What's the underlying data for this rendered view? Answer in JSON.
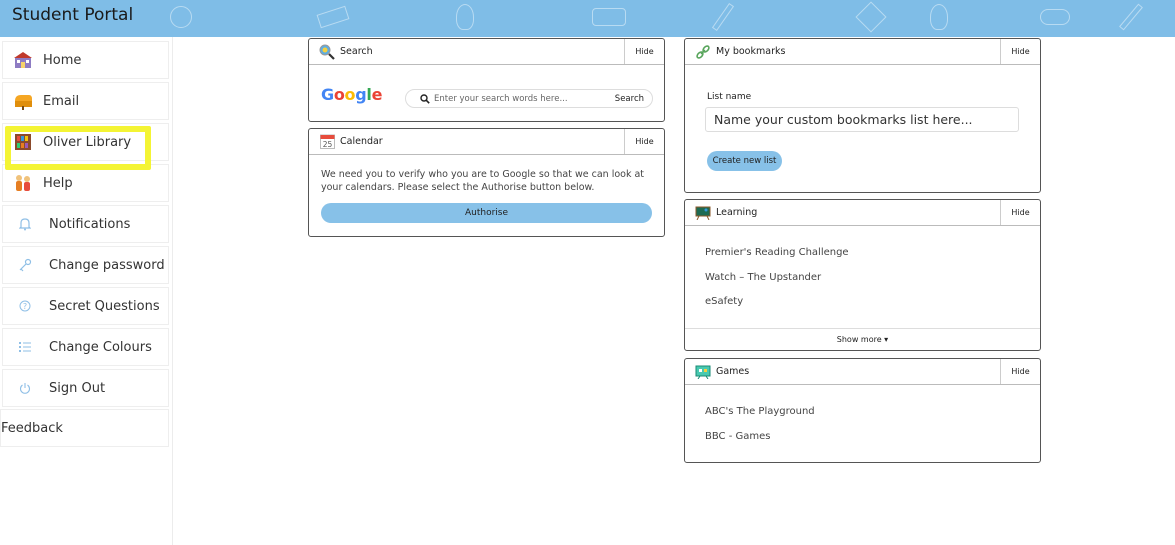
{
  "header": {
    "title": "Student Portal"
  },
  "sidebar": {
    "items": [
      {
        "label": "Home",
        "icon": "school-icon"
      },
      {
        "label": "Email",
        "icon": "mailbox-icon"
      },
      {
        "label": "Oliver Library",
        "icon": "library-icon"
      },
      {
        "label": "Help",
        "icon": "help-icon"
      },
      {
        "label": "Notifications",
        "icon": "bell-icon"
      },
      {
        "label": "Change password",
        "icon": "key-icon"
      },
      {
        "label": "Secret Questions",
        "icon": "question-icon"
      },
      {
        "label": "Change Colours",
        "icon": "list-icon"
      },
      {
        "label": "Sign Out",
        "icon": "power-icon"
      }
    ],
    "feedback": "Feedback"
  },
  "search": {
    "title": "Search",
    "hide": "Hide",
    "placeholder": "Enter your search words here...",
    "button": "Search"
  },
  "calendar": {
    "title": "Calendar",
    "hide": "Hide",
    "icon_day": "25",
    "text": "We need you to verify who you are to Google so that we can look at your calendars. Please select the Authorise button below.",
    "button": "Authorise"
  },
  "bookmarks": {
    "title": "My bookmarks",
    "hide": "Hide",
    "list_label": "List name",
    "placeholder": "Name your custom bookmarks list here...",
    "button": "Create new list"
  },
  "learning": {
    "title": "Learning",
    "hide": "Hide",
    "items": [
      "Premier's Reading Challenge",
      "Watch – The Upstander",
      "eSafety"
    ],
    "show_more": "Show more ▾"
  },
  "games": {
    "title": "Games",
    "hide": "Hide",
    "items": [
      "ABC's The Playground",
      "BBC - Games"
    ]
  },
  "colors": {
    "header": "#7fbde7",
    "button": "#87c1e8",
    "highlight": "#f4f434"
  }
}
